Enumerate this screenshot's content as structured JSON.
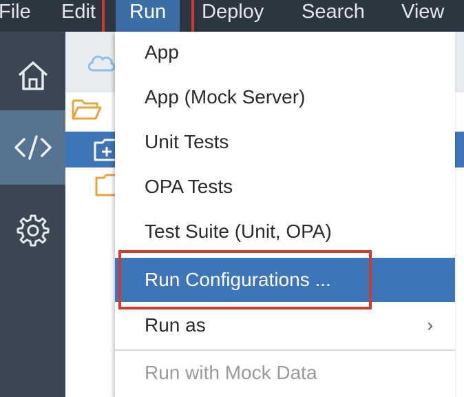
{
  "menubar": {
    "items": [
      {
        "label": "File"
      },
      {
        "label": "Edit"
      },
      {
        "label": "Run"
      },
      {
        "label": "Deploy"
      },
      {
        "label": "Search"
      },
      {
        "label": "View"
      }
    ],
    "active": "Run"
  },
  "sidebar": {
    "items": [
      {
        "icon": "home-icon"
      },
      {
        "icon": "code-icon",
        "active": true
      },
      {
        "icon": "gear-icon"
      }
    ]
  },
  "run_menu": {
    "items": [
      {
        "label": "App"
      },
      {
        "label": "App (Mock Server)"
      },
      {
        "label": "Unit Tests"
      },
      {
        "label": "OPA Tests"
      },
      {
        "label": "Test Suite (Unit, OPA)"
      },
      {
        "label": "Run Configurations ...",
        "selected": true
      },
      {
        "label": "Run as",
        "submenu": true
      },
      {
        "label": "Run with Mock Data",
        "disabled": true
      }
    ],
    "submenu_glyph": "›"
  },
  "colors": {
    "menubar_bg": "#2c3640",
    "accent": "#3d75b8",
    "highlight_box": "#d23a2e",
    "folder": "#e8a33d"
  }
}
